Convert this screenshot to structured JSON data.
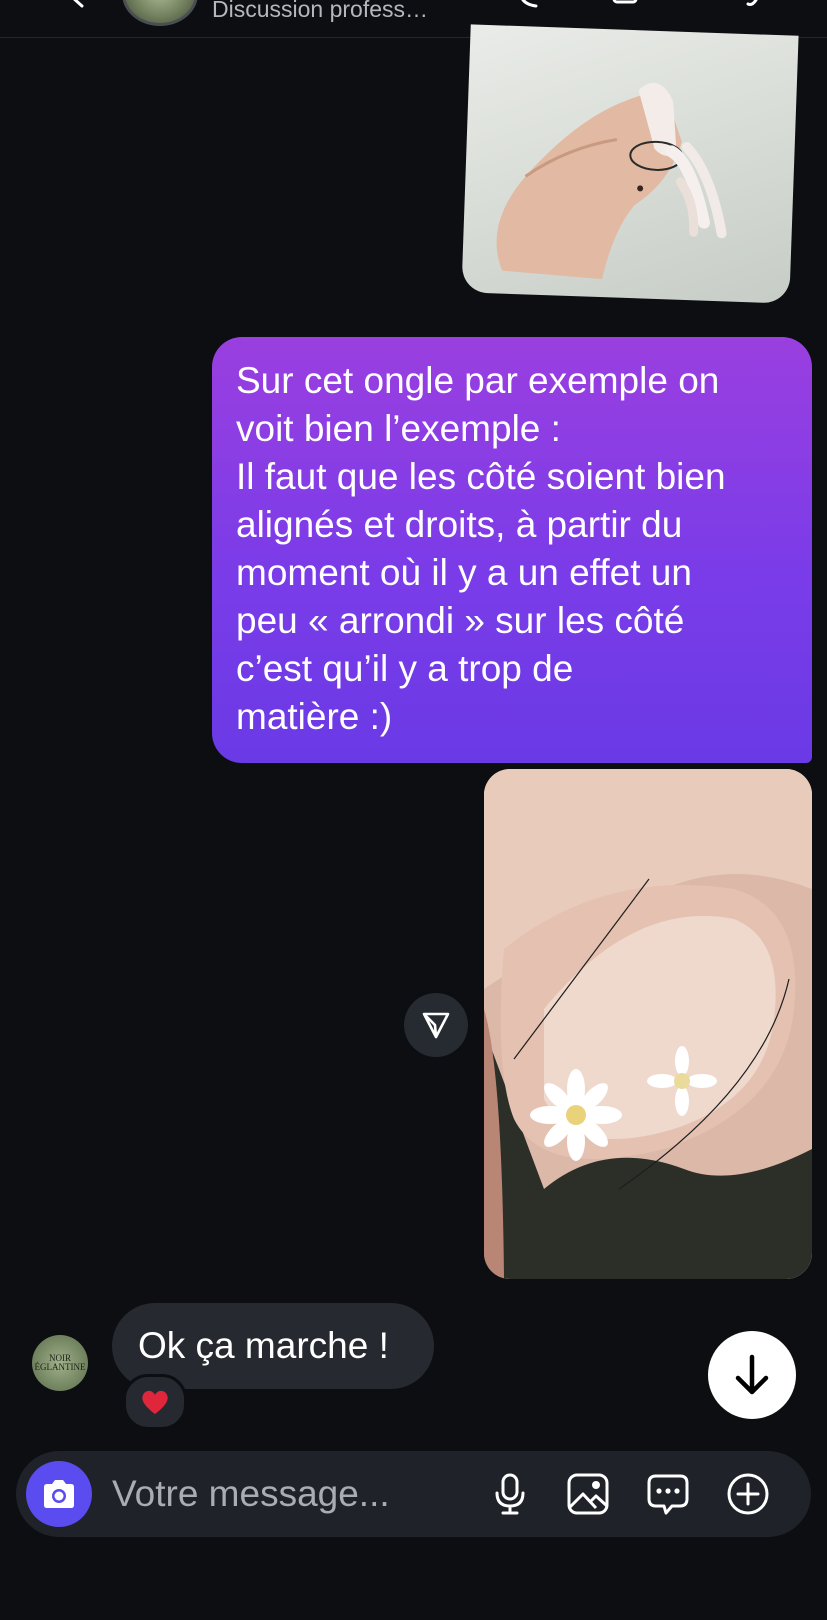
{
  "header": {
    "subtitle": "Discussion profess…"
  },
  "messages": {
    "sent_text": "Sur cet ongle par exemple on\nvoit bien l’exemple :\nIl faut que les côté soient bien\nalignés et droits, à partir du\nmoment où il y a un effet un\npeu « arrondi » sur les côté\nc’est qu’il y a trop de\nmatière :)",
    "received_text": "Ok ça marche !",
    "received_reaction": "❤️",
    "avatar_text": "NOIR ÉGLANTINE"
  },
  "composer": {
    "placeholder": "Votre message..."
  },
  "icons": {
    "camera": "camera-icon",
    "microphone": "microphone-icon",
    "gallery": "image-icon",
    "sticker": "chat-bubble-icon",
    "more": "plus-circle-icon",
    "share": "send-icon",
    "scroll": "arrow-down-icon"
  },
  "colors": {
    "background": "#0c0e12",
    "sent_bubble_top": "#9a3fe0",
    "sent_bubble_bottom": "#6a3ae6",
    "received_bubble": "#262930",
    "camera_button": "#5b4cf0"
  }
}
